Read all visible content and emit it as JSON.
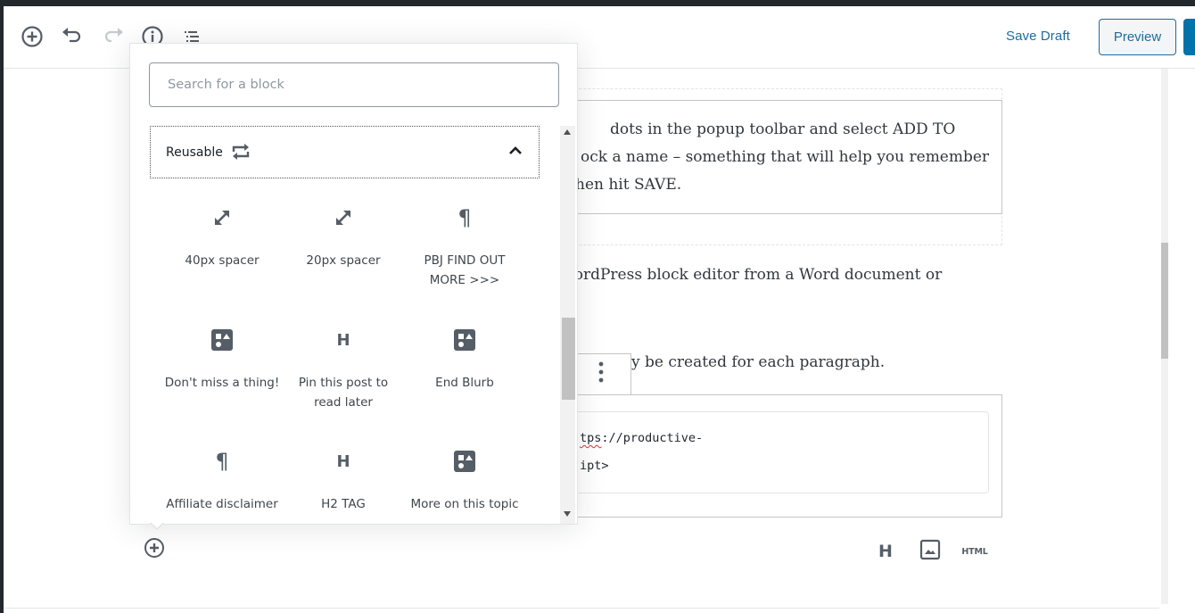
{
  "header": {
    "toolbar_icons": [
      {
        "name": "add-block-icon",
        "semantic": "plus-circle",
        "enabled": true
      },
      {
        "name": "undo-icon",
        "semantic": "undo-arrow",
        "enabled": true
      },
      {
        "name": "redo-icon",
        "semantic": "redo-arrow",
        "enabled": false
      },
      {
        "name": "info-icon",
        "semantic": "info-circle",
        "enabled": true
      },
      {
        "name": "outline-icon",
        "semantic": "list-view",
        "enabled": true
      }
    ],
    "save_draft_label": "Save Draft",
    "preview_label": "Preview",
    "colors": {
      "link": "#1e6c9f",
      "primary": "#0073aa",
      "icon": "#555d66"
    }
  },
  "inserter": {
    "search_placeholder": "Search for a block",
    "search_value": "",
    "panel": {
      "title": "Reusable",
      "title_icon": "reusable-arrows-icon",
      "expanded": true,
      "toggle_icon": "chevron-up-icon"
    },
    "blocks": [
      {
        "label": "40px spacer",
        "icon": "resize-arrows"
      },
      {
        "label": "20px spacer",
        "icon": "resize-arrows"
      },
      {
        "label": "PBJ FIND OUT MORE >>>",
        "icon": "paragraph"
      },
      {
        "label": "Don't miss a thing!",
        "icon": "shapes"
      },
      {
        "label": "Pin this post to read later",
        "icon": "heading"
      },
      {
        "label": "End Blurb",
        "icon": "shapes"
      },
      {
        "label": "Affiliate disclaimer",
        "icon": "paragraph"
      },
      {
        "label": "H2 TAG",
        "icon": "heading"
      },
      {
        "label": "More on this topic",
        "icon": "shapes"
      }
    ],
    "scroll_position": 0.5
  },
  "editor": {
    "quote_lines": [
      "dots in the popup toolbar and select ADD TO",
      "ock a name – something that will help you remember",
      "hen hit SAVE."
    ],
    "paragraph_1": "/ordPress block editor from a Word document or",
    "paragraph_2": "y be created for each paragraph.",
    "code_lines": {
      "line_1_misspelled": "tps",
      "line_1_rest": "://productive-",
      "line_2": "ipt>"
    },
    "shortcuts": {
      "heading_label": "H",
      "html_label": "HTML"
    }
  }
}
